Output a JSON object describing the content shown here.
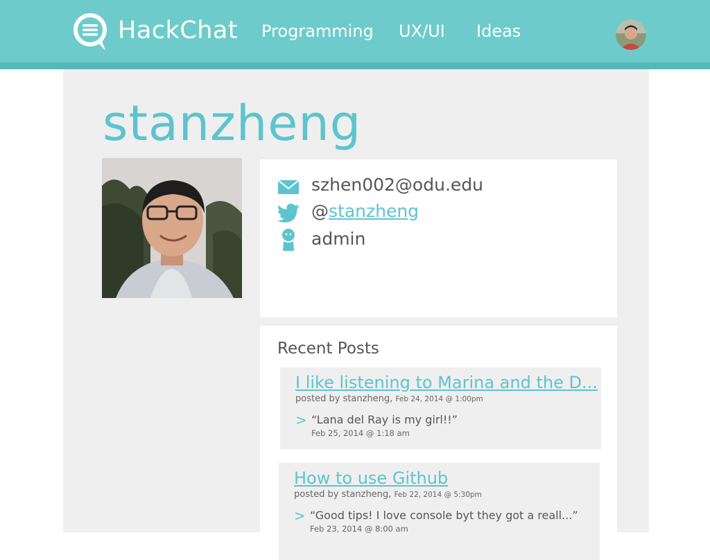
{
  "header": {
    "brand": "HackChat",
    "nav": [
      {
        "label": "Programming"
      },
      {
        "label": "UX/UI"
      },
      {
        "label": "Ideas"
      }
    ],
    "colors": {
      "bar": "#6ecbcb",
      "stripe": "#56b9b9"
    }
  },
  "profile": {
    "username": "stanzheng",
    "email": "szhen002@odu.edu",
    "twitter_prefix": "@",
    "twitter_handle": "stanzheng",
    "role": "admin",
    "accent": "#5cc4cf"
  },
  "recent_posts": {
    "heading": "Recent Posts",
    "posts": [
      {
        "title": "I like listening to Marina and the D...",
        "posted_by_prefix": "posted by ",
        "author": "stanzheng",
        "date": "Feb 24, 2014 @ 1:00pm",
        "comment_arrow": ">",
        "comment": "“Lana del Ray is my girl!!”",
        "comment_date": "Feb 25, 2014 @ 1:18 am"
      },
      {
        "title": "How to use Github",
        "posted_by_prefix": "posted by ",
        "author": "stanzheng",
        "date": "Feb 22, 2014 @ 5:30pm",
        "comment_arrow": ">",
        "comment": "“Good tips! I love console byt they got a reall...”",
        "comment_date": "Feb 23, 2014 @ 8:00 am"
      }
    ]
  },
  "icons": {
    "logo": "chat-bubble-menu-icon",
    "email": "envelope-icon",
    "twitter": "twitter-bird-icon",
    "role": "person-icon"
  }
}
